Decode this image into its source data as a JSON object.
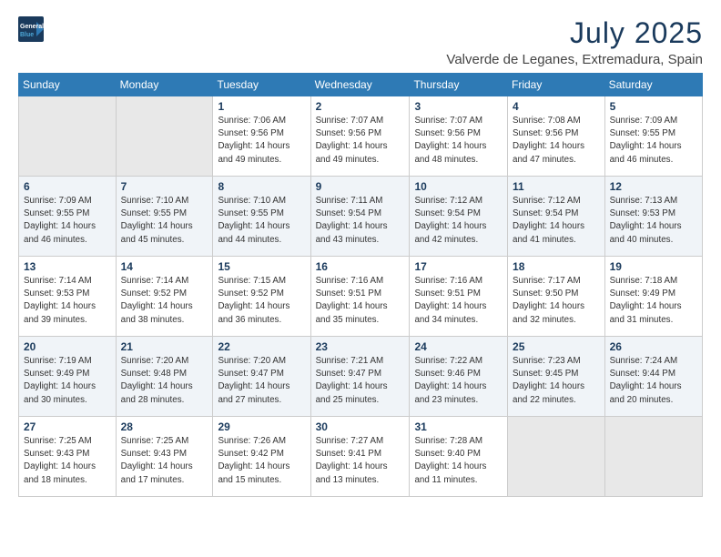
{
  "logo": {
    "line1": "General",
    "line2": "Blue"
  },
  "title": "July 2025",
  "location": "Valverde de Leganes, Extremadura, Spain",
  "weekdays": [
    "Sunday",
    "Monday",
    "Tuesday",
    "Wednesday",
    "Thursday",
    "Friday",
    "Saturday"
  ],
  "weeks": [
    [
      {
        "day": "",
        "info": ""
      },
      {
        "day": "",
        "info": ""
      },
      {
        "day": "1",
        "info": "Sunrise: 7:06 AM\nSunset: 9:56 PM\nDaylight: 14 hours and 49 minutes."
      },
      {
        "day": "2",
        "info": "Sunrise: 7:07 AM\nSunset: 9:56 PM\nDaylight: 14 hours and 49 minutes."
      },
      {
        "day": "3",
        "info": "Sunrise: 7:07 AM\nSunset: 9:56 PM\nDaylight: 14 hours and 48 minutes."
      },
      {
        "day": "4",
        "info": "Sunrise: 7:08 AM\nSunset: 9:56 PM\nDaylight: 14 hours and 47 minutes."
      },
      {
        "day": "5",
        "info": "Sunrise: 7:09 AM\nSunset: 9:55 PM\nDaylight: 14 hours and 46 minutes."
      }
    ],
    [
      {
        "day": "6",
        "info": "Sunrise: 7:09 AM\nSunset: 9:55 PM\nDaylight: 14 hours and 46 minutes."
      },
      {
        "day": "7",
        "info": "Sunrise: 7:10 AM\nSunset: 9:55 PM\nDaylight: 14 hours and 45 minutes."
      },
      {
        "day": "8",
        "info": "Sunrise: 7:10 AM\nSunset: 9:55 PM\nDaylight: 14 hours and 44 minutes."
      },
      {
        "day": "9",
        "info": "Sunrise: 7:11 AM\nSunset: 9:54 PM\nDaylight: 14 hours and 43 minutes."
      },
      {
        "day": "10",
        "info": "Sunrise: 7:12 AM\nSunset: 9:54 PM\nDaylight: 14 hours and 42 minutes."
      },
      {
        "day": "11",
        "info": "Sunrise: 7:12 AM\nSunset: 9:54 PM\nDaylight: 14 hours and 41 minutes."
      },
      {
        "day": "12",
        "info": "Sunrise: 7:13 AM\nSunset: 9:53 PM\nDaylight: 14 hours and 40 minutes."
      }
    ],
    [
      {
        "day": "13",
        "info": "Sunrise: 7:14 AM\nSunset: 9:53 PM\nDaylight: 14 hours and 39 minutes."
      },
      {
        "day": "14",
        "info": "Sunrise: 7:14 AM\nSunset: 9:52 PM\nDaylight: 14 hours and 38 minutes."
      },
      {
        "day": "15",
        "info": "Sunrise: 7:15 AM\nSunset: 9:52 PM\nDaylight: 14 hours and 36 minutes."
      },
      {
        "day": "16",
        "info": "Sunrise: 7:16 AM\nSunset: 9:51 PM\nDaylight: 14 hours and 35 minutes."
      },
      {
        "day": "17",
        "info": "Sunrise: 7:16 AM\nSunset: 9:51 PM\nDaylight: 14 hours and 34 minutes."
      },
      {
        "day": "18",
        "info": "Sunrise: 7:17 AM\nSunset: 9:50 PM\nDaylight: 14 hours and 32 minutes."
      },
      {
        "day": "19",
        "info": "Sunrise: 7:18 AM\nSunset: 9:49 PM\nDaylight: 14 hours and 31 minutes."
      }
    ],
    [
      {
        "day": "20",
        "info": "Sunrise: 7:19 AM\nSunset: 9:49 PM\nDaylight: 14 hours and 30 minutes."
      },
      {
        "day": "21",
        "info": "Sunrise: 7:20 AM\nSunset: 9:48 PM\nDaylight: 14 hours and 28 minutes."
      },
      {
        "day": "22",
        "info": "Sunrise: 7:20 AM\nSunset: 9:47 PM\nDaylight: 14 hours and 27 minutes."
      },
      {
        "day": "23",
        "info": "Sunrise: 7:21 AM\nSunset: 9:47 PM\nDaylight: 14 hours and 25 minutes."
      },
      {
        "day": "24",
        "info": "Sunrise: 7:22 AM\nSunset: 9:46 PM\nDaylight: 14 hours and 23 minutes."
      },
      {
        "day": "25",
        "info": "Sunrise: 7:23 AM\nSunset: 9:45 PM\nDaylight: 14 hours and 22 minutes."
      },
      {
        "day": "26",
        "info": "Sunrise: 7:24 AM\nSunset: 9:44 PM\nDaylight: 14 hours and 20 minutes."
      }
    ],
    [
      {
        "day": "27",
        "info": "Sunrise: 7:25 AM\nSunset: 9:43 PM\nDaylight: 14 hours and 18 minutes."
      },
      {
        "day": "28",
        "info": "Sunrise: 7:25 AM\nSunset: 9:43 PM\nDaylight: 14 hours and 17 minutes."
      },
      {
        "day": "29",
        "info": "Sunrise: 7:26 AM\nSunset: 9:42 PM\nDaylight: 14 hours and 15 minutes."
      },
      {
        "day": "30",
        "info": "Sunrise: 7:27 AM\nSunset: 9:41 PM\nDaylight: 14 hours and 13 minutes."
      },
      {
        "day": "31",
        "info": "Sunrise: 7:28 AM\nSunset: 9:40 PM\nDaylight: 14 hours and 11 minutes."
      },
      {
        "day": "",
        "info": ""
      },
      {
        "day": "",
        "info": ""
      }
    ]
  ]
}
